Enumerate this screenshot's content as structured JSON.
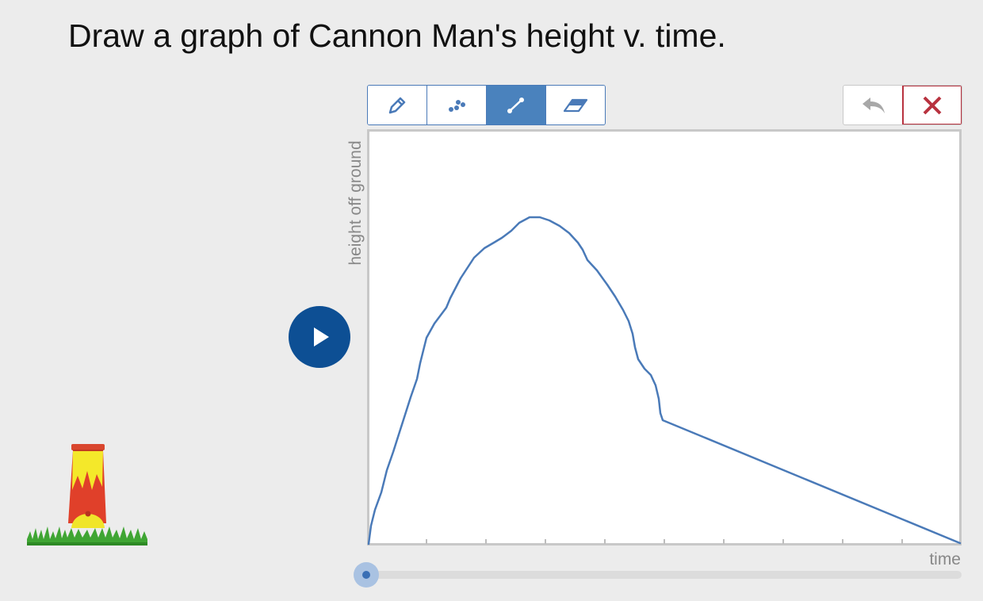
{
  "prompt": "Draw a graph of Cannon Man's height v. time.",
  "toolbar": {
    "tools": [
      {
        "name": "pencil",
        "icon": "pencil-icon",
        "active": false
      },
      {
        "name": "points",
        "icon": "dots-icon",
        "active": false
      },
      {
        "name": "line",
        "icon": "line-segment-icon",
        "active": true
      },
      {
        "name": "eraser",
        "icon": "eraser-icon",
        "active": false
      }
    ],
    "undo_icon": "undo-icon",
    "clear_icon": "close-icon"
  },
  "graph": {
    "y_label": "height off ground",
    "x_label": "time",
    "tick_count": 9,
    "line_color": "#4a7ab8"
  },
  "slider": {
    "value": 0
  },
  "colors": {
    "accent": "#4a82bd",
    "play": "#0d4f94",
    "danger": "#b8323f"
  }
}
